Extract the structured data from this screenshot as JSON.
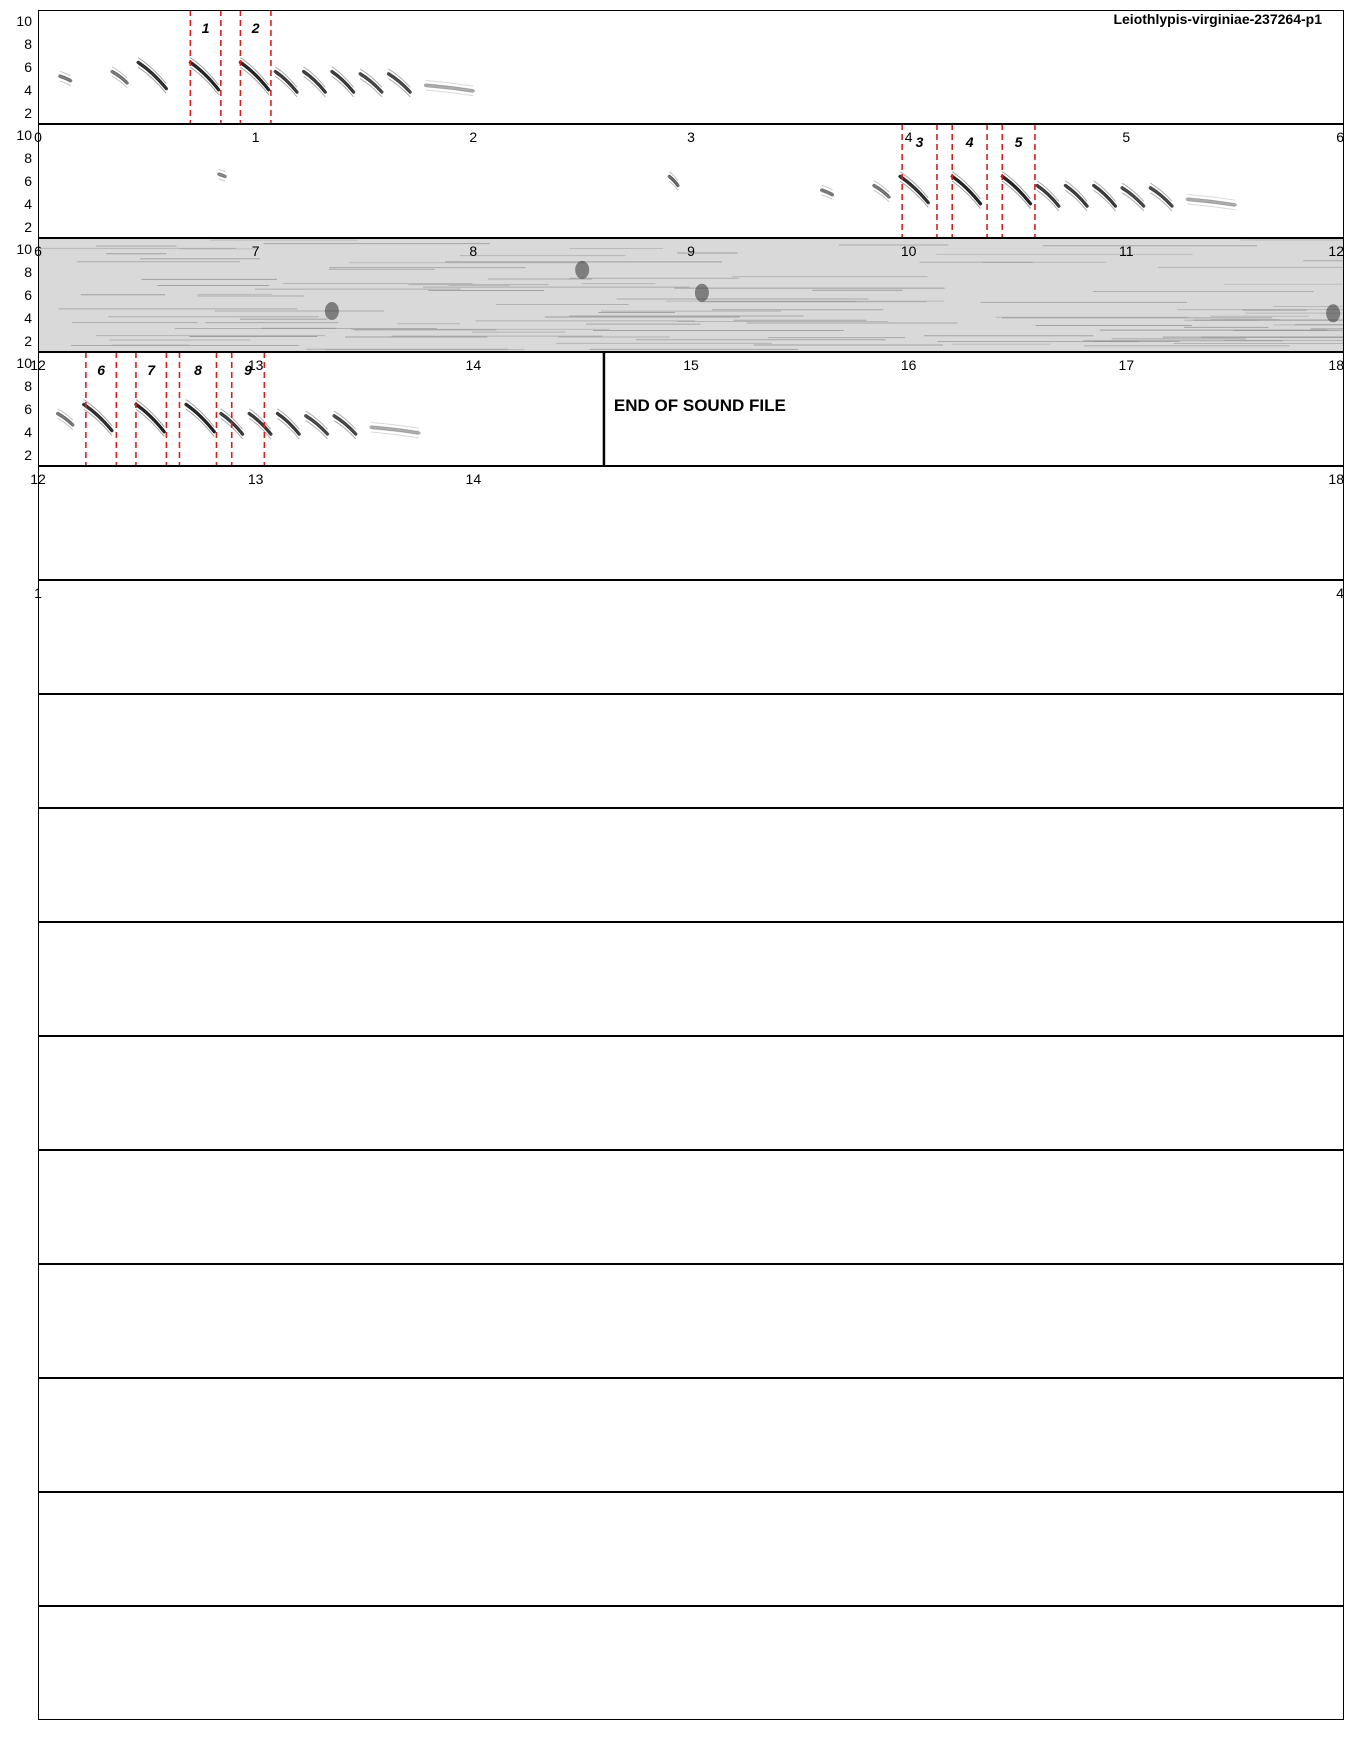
{
  "title": "Leiothlypis-virginiae-237264-p1",
  "end_label": "END OF SOUND FILE",
  "chart_data": {
    "type": "spectrogram",
    "title": "Leiothlypis-virginiae-237264-p1",
    "ylabel": "",
    "xlabel": "",
    "y_ticks": [
      "2",
      "4",
      "6",
      "8",
      "10"
    ],
    "ylim": [
      1,
      11
    ],
    "seconds_per_panel": 6,
    "panels": [
      {
        "x_ticks": [
          "0",
          "1",
          "2",
          "3",
          "4",
          "5",
          "6"
        ],
        "state": "signal"
      },
      {
        "x_ticks": [
          "6",
          "7",
          "8",
          "9",
          "10",
          "11",
          "12"
        ],
        "state": "signal"
      },
      {
        "x_ticks": [
          "12",
          "13",
          "14",
          "15",
          "16",
          "17",
          "18"
        ],
        "state": "noise"
      },
      {
        "x_ticks": [
          "12",
          "13",
          "14",
          "",
          "",
          "",
          "18"
        ],
        "state": "end"
      },
      {
        "x_ticks": [
          "1",
          "",
          "",
          "",
          "",
          "",
          "4"
        ],
        "state": "empty"
      },
      {
        "x_ticks": [],
        "state": "empty"
      },
      {
        "x_ticks": [],
        "state": "empty"
      },
      {
        "x_ticks": [],
        "state": "empty"
      },
      {
        "x_ticks": [],
        "state": "empty"
      },
      {
        "x_ticks": [],
        "state": "empty"
      },
      {
        "x_ticks": [],
        "state": "empty"
      },
      {
        "x_ticks": [],
        "state": "empty"
      },
      {
        "x_ticks": [],
        "state": "empty"
      },
      {
        "x_ticks": [],
        "state": "empty"
      },
      {
        "x_ticks": [],
        "state": "empty"
      }
    ],
    "end_of_file_time": 14.6,
    "selections": [
      {
        "label": "1",
        "panel": 0,
        "start": 0.7,
        "end": 0.84
      },
      {
        "label": "2",
        "panel": 0,
        "start": 0.93,
        "end": 1.07
      },
      {
        "label": "3",
        "panel": 1,
        "start": 3.97,
        "end": 4.13
      },
      {
        "label": "4",
        "panel": 1,
        "start": 4.2,
        "end": 4.36
      },
      {
        "label": "5",
        "panel": 1,
        "start": 4.43,
        "end": 4.58
      },
      {
        "label": "6",
        "panel": 3,
        "start": 0.22,
        "end": 0.36
      },
      {
        "label": "7",
        "panel": 3,
        "start": 0.45,
        "end": 0.59
      },
      {
        "label": "8",
        "panel": 3,
        "start": 0.65,
        "end": 0.82
      },
      {
        "label": "9",
        "panel": 3,
        "start": 0.89,
        "end": 1.04
      }
    ],
    "colors": {
      "selection": "#d62020",
      "ink": "#111111",
      "noise": "#8a8a8a"
    }
  }
}
